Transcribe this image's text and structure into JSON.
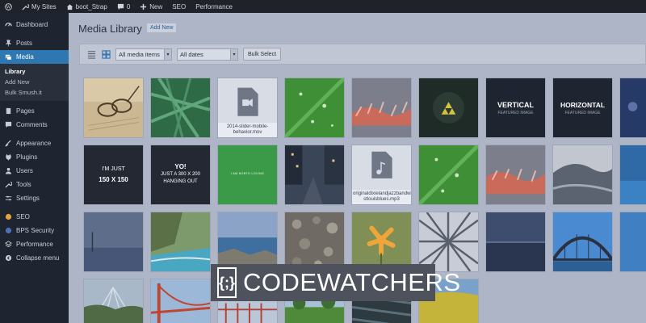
{
  "adminbar": {
    "my_sites": "My Sites",
    "site_name": "boot_Strap",
    "comments_count": "0",
    "new_label": "New",
    "seo": "SEO",
    "performance": "Performance"
  },
  "sidebar": {
    "dashboard": "Dashboard",
    "posts": "Posts",
    "media": "Media",
    "submenu": [
      "Library",
      "Add New",
      "Bulk Smush.it"
    ],
    "pages": "Pages",
    "comments": "Comments",
    "appearance": "Appearance",
    "plugins": "Plugins",
    "users": "Users",
    "tools": "Tools",
    "settings": "Settings",
    "seo": "SEO",
    "bps_security": "BPS Security",
    "performance": "Performance",
    "collapse": "Collapse menu"
  },
  "main": {
    "title": "Media Library",
    "add_new": "Add New",
    "filter_type": "All media items",
    "filter_date": "All dates",
    "bulk_select": "Bulk Select"
  },
  "tiles": {
    "mov_file": "2014-slider-mobile-behavior.mov",
    "mp3_file": "originaldixielandjazzbandwithalbernard-stlouisblues.mp3",
    "vertical_title": "VERTICAL",
    "vertical_sub": "FEATURED IMAGE",
    "horizontal_title": "HORIZONTAL",
    "horizontal_sub": "FEATURED IMAGE",
    "im_just": "I'M JUST",
    "size_150": "150 X 150",
    "yo": "YO!",
    "just_a": "JUST A 300 X 200",
    "hanging_out": "HANGING OUT",
    "north_text": "I AM NORTH LOVING"
  },
  "watermark": {
    "text": "CODEWATCHERS",
    "logo": "{;}"
  },
  "colors": {
    "accent": "#2e77b0",
    "sidebar": "#1e2430",
    "adminbar": "#1f2229"
  }
}
